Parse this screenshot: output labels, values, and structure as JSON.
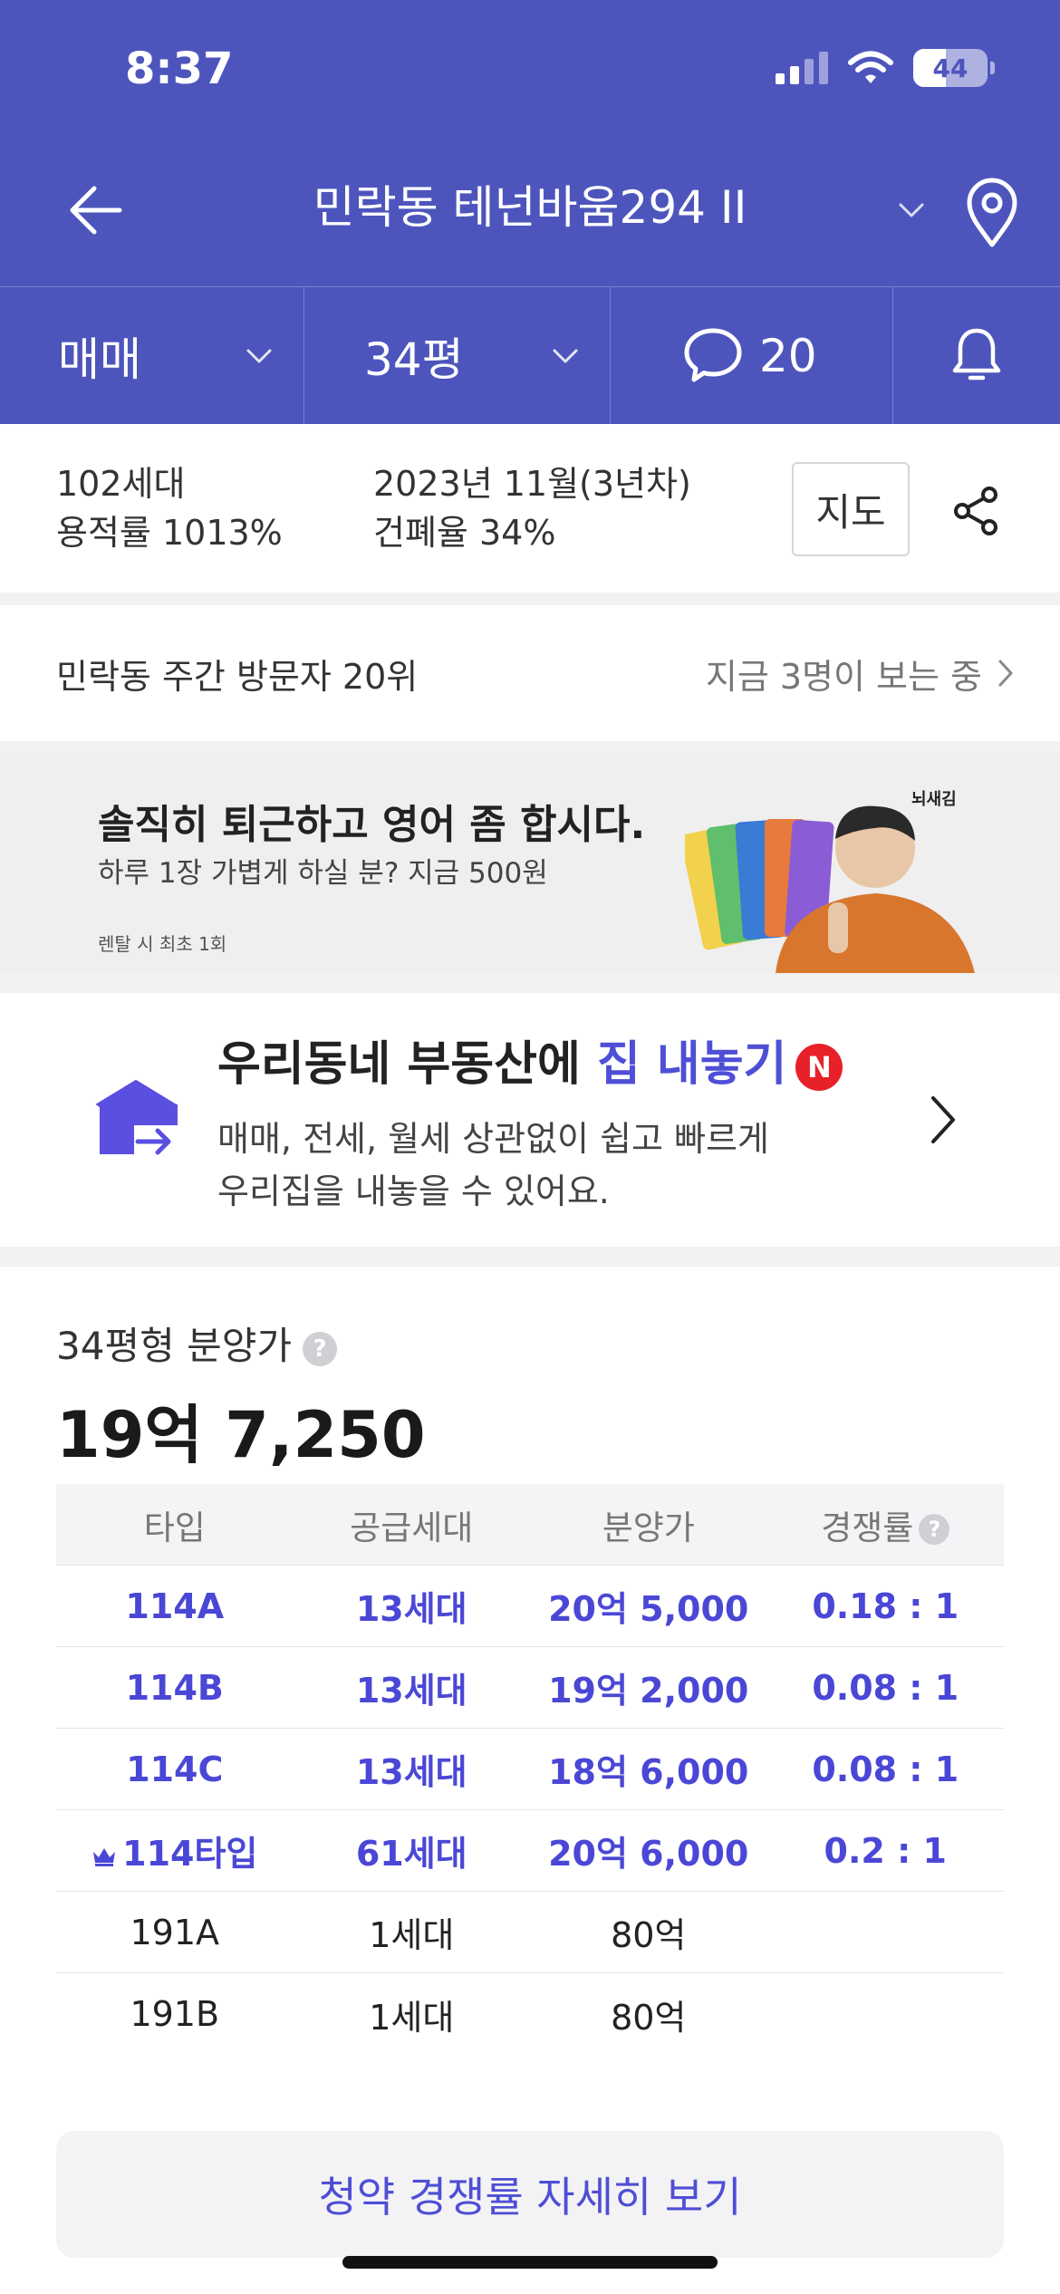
{
  "status": {
    "time": "8:37",
    "battery": "44",
    "battery_level": 0.44
  },
  "header": {
    "title": "민락동 테넌바움294 II"
  },
  "filters": {
    "deal_type": "매매",
    "size": "34평",
    "comments_count": "20"
  },
  "info": {
    "households": "102세대",
    "floor_area_ratio": "용적률 1013%",
    "built": "2023년 11월(3년차)",
    "coverage_ratio": "건폐율 34%",
    "map_button": "지도"
  },
  "visitors": {
    "rank": "민락동 주간 방문자 20위",
    "viewing_now": "지금 3명이 보는 중"
  },
  "ad": {
    "headline": "솔직히 퇴근하고 영어 좀 합시다.",
    "sub": "하루 1장 가볍게 하실 분? 지금 500원",
    "note": "렌탈 시 최초 1회",
    "brand": "뇌새김"
  },
  "promo": {
    "title_prefix": "우리동네 부동산에 ",
    "title_highlight": "집 내놓기",
    "badge": "N",
    "desc_line1": "매매, 전세, 월세 상관없이 쉽고 빠르게",
    "desc_line2": "우리집을 내놓을 수 있어요."
  },
  "price": {
    "label": "34평형 분양가",
    "help": "?",
    "value": "19억 7,250",
    "table": {
      "headers": [
        "타입",
        "공급세대",
        "분양가",
        "경쟁률"
      ],
      "rows": [
        [
          "114A",
          "13세대",
          "20억 5,000",
          "0.18 : 1"
        ],
        [
          "114B",
          "13세대",
          "19억 2,000",
          "0.08 : 1"
        ],
        [
          "114C",
          "13세대",
          "18억 6,000",
          "0.08 : 1"
        ],
        [
          "114타입",
          "61세대",
          "20억 6,000",
          "0.2 : 1"
        ],
        [
          "191A",
          "1세대",
          "80억",
          ""
        ],
        [
          "191B",
          "1세대",
          "80억",
          ""
        ]
      ]
    },
    "cta": "청약 경쟁률 자세히 보기"
  },
  "colors": {
    "brand": "#4d55bd",
    "accent": "#4e4ed6",
    "badge": "#e8202a"
  }
}
